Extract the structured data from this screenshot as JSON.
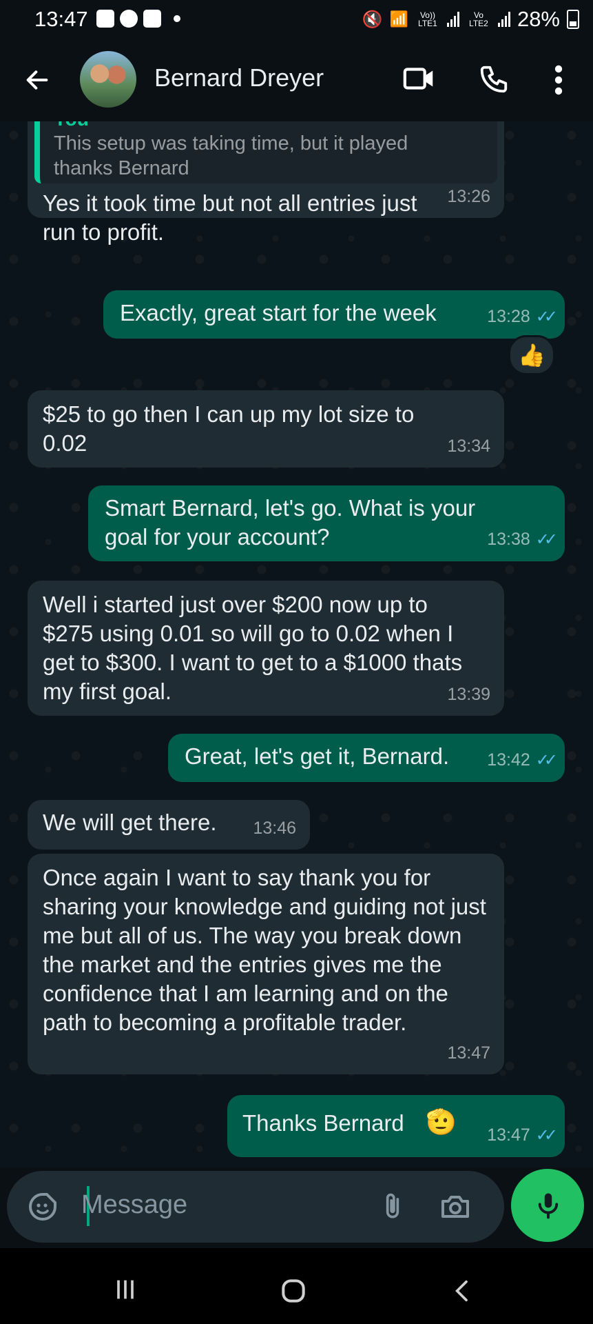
{
  "status_bar": {
    "time": "13:47",
    "lte1": "Vo)) LTE1",
    "lte2": "Vo LTE2",
    "battery": "28%"
  },
  "header": {
    "contact_name": "Bernard Dreyer",
    "back_icon": "arrow-left-icon",
    "video_icon": "video-camera-icon",
    "call_icon": "phone-icon",
    "menu_icon": "more-vertical-icon"
  },
  "messages": [
    {
      "direction": "in",
      "quote_author": "You",
      "quote_text": "This setup was taking time, but it played thanks Bernard",
      "text": "Yes it took time but not all entries just run to profit.",
      "time": "13:26"
    },
    {
      "direction": "out",
      "text": "Exactly, great start for the week",
      "time": "13:28",
      "reaction": "👍"
    },
    {
      "direction": "in",
      "text": "$25 to go then I can up my lot size to 0.02",
      "time": "13:34"
    },
    {
      "direction": "out",
      "text": "Smart Bernard, let's go. What is your goal for your account?",
      "time": "13:38"
    },
    {
      "direction": "in",
      "text": "Well i started just over $200 now up to $275 using 0.01 so will go to 0.02 when I get to $300. I want to get to a $1000 thats my first goal.",
      "time": "13:39"
    },
    {
      "direction": "out",
      "text": "Great, let's get it, Bernard.",
      "time": "13:42"
    },
    {
      "direction": "in",
      "text": "We will get there.",
      "time": "13:46"
    },
    {
      "direction": "in",
      "text": "Once again I want to say thank you for sharing your knowledge and guiding not just me but all of us. The way you break down the market and the entries gives me the confidence that I am learning and on the path to becoming a profitable trader.",
      "time": "13:47"
    },
    {
      "direction": "out",
      "text": "Thanks Bernard",
      "emoji": "🫡",
      "time": "13:47"
    }
  ],
  "composer": {
    "placeholder": "Message",
    "emoji_icon": "sticker-icon",
    "attach_icon": "paperclip-icon",
    "camera_icon": "camera-icon",
    "mic_icon": "microphone-icon"
  },
  "colors": {
    "incoming": "#202c33",
    "outgoing": "#005c4b",
    "accent": "#21c063",
    "read_ticks": "#53bdeb"
  }
}
